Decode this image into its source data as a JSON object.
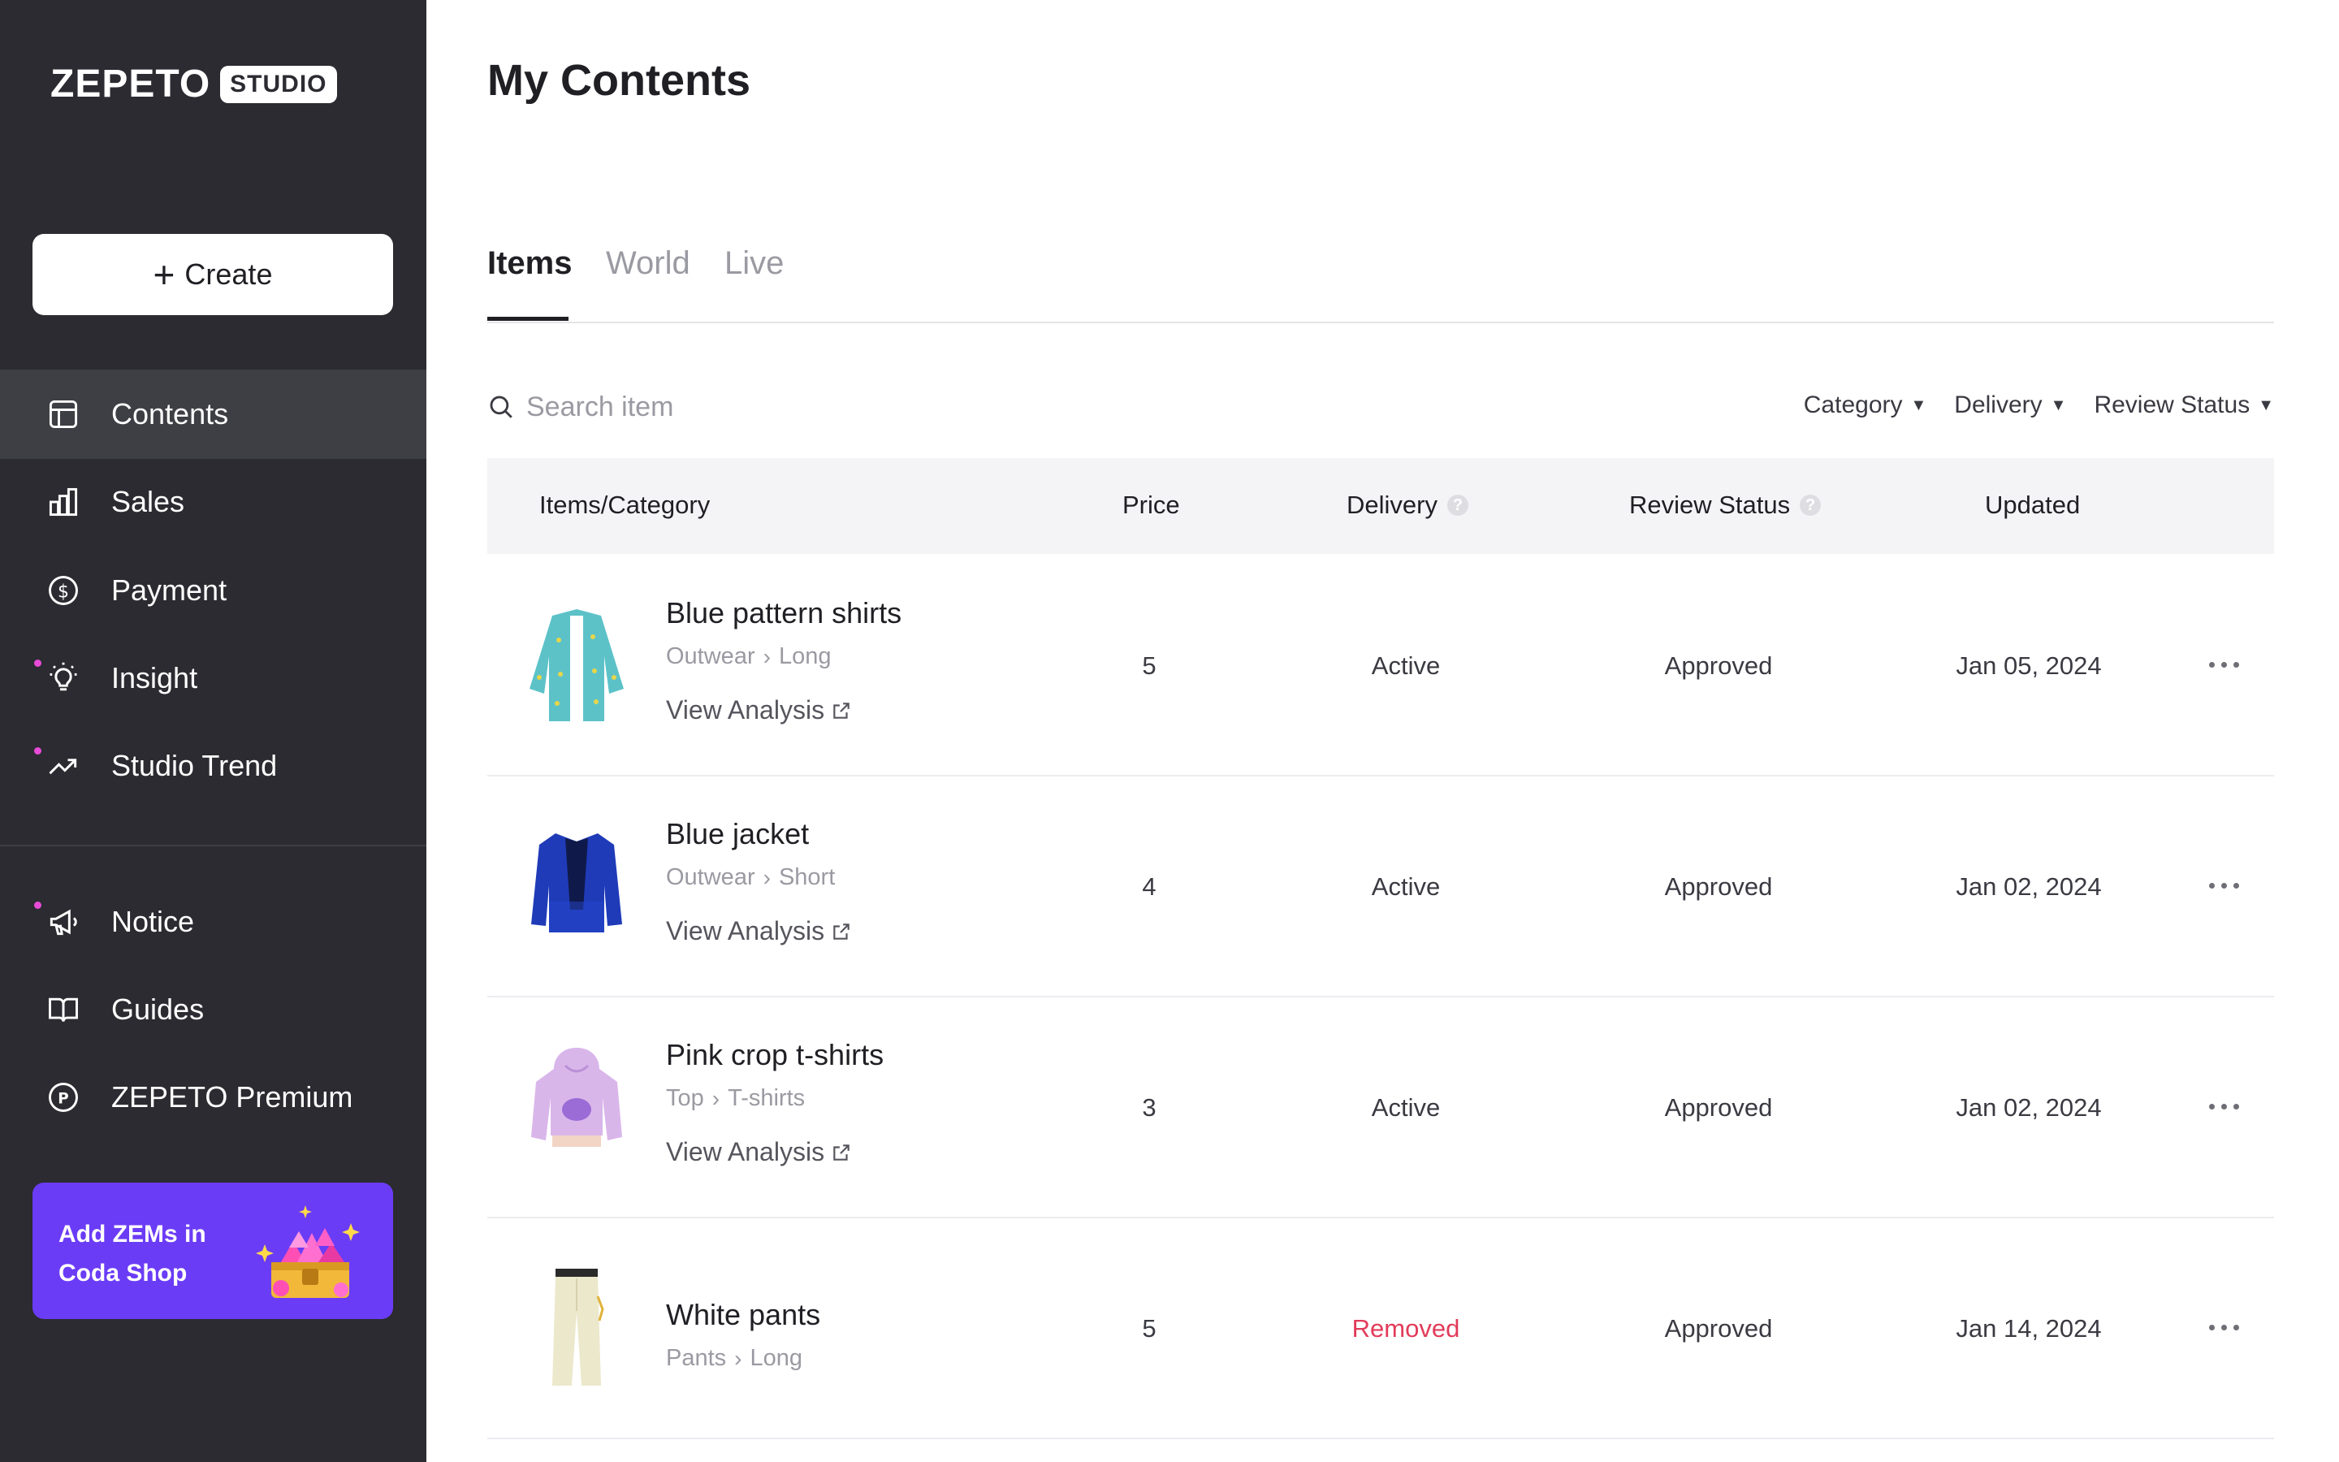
{
  "sidebar": {
    "logo_word": "ZEPETO",
    "logo_badge": "STUDIO",
    "create_label": "Create",
    "items": [
      {
        "label": "Contents",
        "icon": "layout-icon",
        "active": true,
        "new_dot": false
      },
      {
        "label": "Sales",
        "icon": "bar-chart-icon",
        "active": false,
        "new_dot": false
      },
      {
        "label": "Payment",
        "icon": "dollar-circle-icon",
        "active": false,
        "new_dot": false
      },
      {
        "label": "Insight",
        "icon": "lightbulb-icon",
        "active": false,
        "new_dot": true
      },
      {
        "label": "Studio Trend",
        "icon": "trend-icon",
        "active": false,
        "new_dot": true
      },
      {
        "label": "Notice",
        "icon": "megaphone-icon",
        "active": false,
        "new_dot": true
      },
      {
        "label": "Guides",
        "icon": "book-icon",
        "active": false,
        "new_dot": false
      },
      {
        "label": "ZEPETO Premium",
        "icon": "premium-p-icon",
        "active": false,
        "new_dot": false
      }
    ],
    "promo": {
      "line1": "Add ZEMs in",
      "line2": "Coda Shop"
    }
  },
  "main": {
    "title": "My Contents",
    "tabs": [
      "Items",
      "World",
      "Live"
    ],
    "active_tab": "Items",
    "search": {
      "placeholder": "Search item",
      "value": ""
    },
    "filters": [
      "Category",
      "Delivery",
      "Review Status"
    ],
    "columns": {
      "item": "Items/Category",
      "price": "Price",
      "delivery": "Delivery",
      "review": "Review Status",
      "updated": "Updated"
    },
    "view_analysis_label": "View Analysis",
    "rows": [
      {
        "name": "Blue pattern shirts",
        "cat1": "Outwear",
        "cat2": "Long",
        "price": "5",
        "delivery": "Active",
        "review": "Approved",
        "updated": "Jan 05, 2024",
        "has_analysis": true
      },
      {
        "name": "Blue jacket",
        "cat1": "Outwear",
        "cat2": "Short",
        "price": "4",
        "delivery": "Active",
        "review": "Approved",
        "updated": "Jan 02, 2024",
        "has_analysis": true
      },
      {
        "name": "Pink crop t-shirts",
        "cat1": "Top",
        "cat2": "T-shirts",
        "price": "3",
        "delivery": "Active",
        "review": "Approved",
        "updated": "Jan 02, 2024",
        "has_analysis": true
      },
      {
        "name": "White pants",
        "cat1": "Pants",
        "cat2": "Long",
        "price": "5",
        "delivery": "Removed",
        "review": "Approved",
        "updated": "Jan 14, 2024",
        "has_analysis": false
      }
    ]
  },
  "colors": {
    "sidebar_bg": "#2b2b31",
    "accent_purple": "#6b3cf6",
    "removed_red": "#e23b5a",
    "new_dot": "#e84bd8"
  }
}
